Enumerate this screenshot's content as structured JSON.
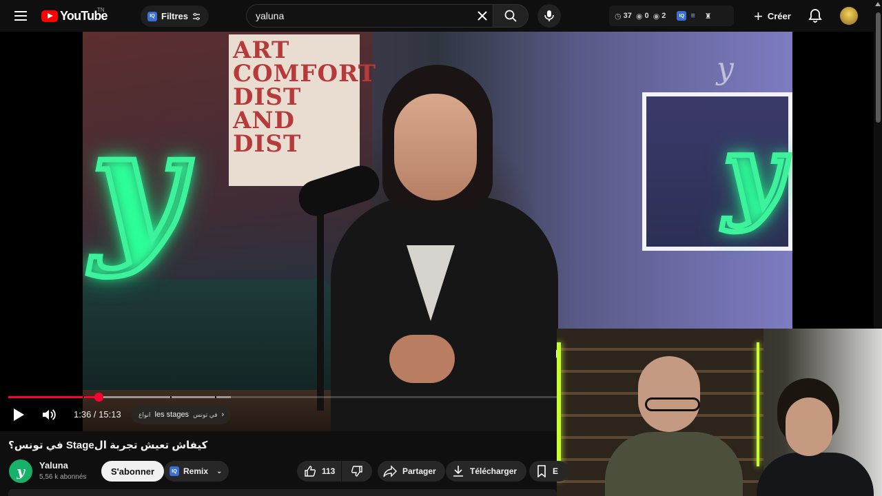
{
  "header": {
    "logo_text": "YouTube",
    "country_code": "TN",
    "filters_label": "Filtres",
    "iq_badge": "IQ",
    "search_value": "yaluna",
    "extension_stats": {
      "views": "37",
      "likes": "0",
      "comments": "2"
    },
    "create_label": "Créer"
  },
  "player": {
    "current_time": "1:36",
    "duration": "15:13",
    "time_separator": " / ",
    "progress": 0.105,
    "buffered": 0.26,
    "chapter": {
      "prefix_ar": "انواع",
      "main": "les stages",
      "suffix_ar": "في تونس"
    },
    "watermark": "y"
  },
  "video": {
    "title": "في تونس؟ Stageكيفاش تعيش تجربة ال",
    "channel_name": "Yaluna",
    "channel_avatar_letter": "y",
    "subscribers": "5,56 k abonnés",
    "subscribe_label": "S'abonner",
    "remix_label": "Remix",
    "like_count": "113",
    "share_label": "Partager",
    "download_label": "Télécharger",
    "save_label": "E"
  },
  "colors": {
    "accent_red": "#ff0033",
    "neon_green": "#3cf29a",
    "background": "#0f0f0f"
  }
}
